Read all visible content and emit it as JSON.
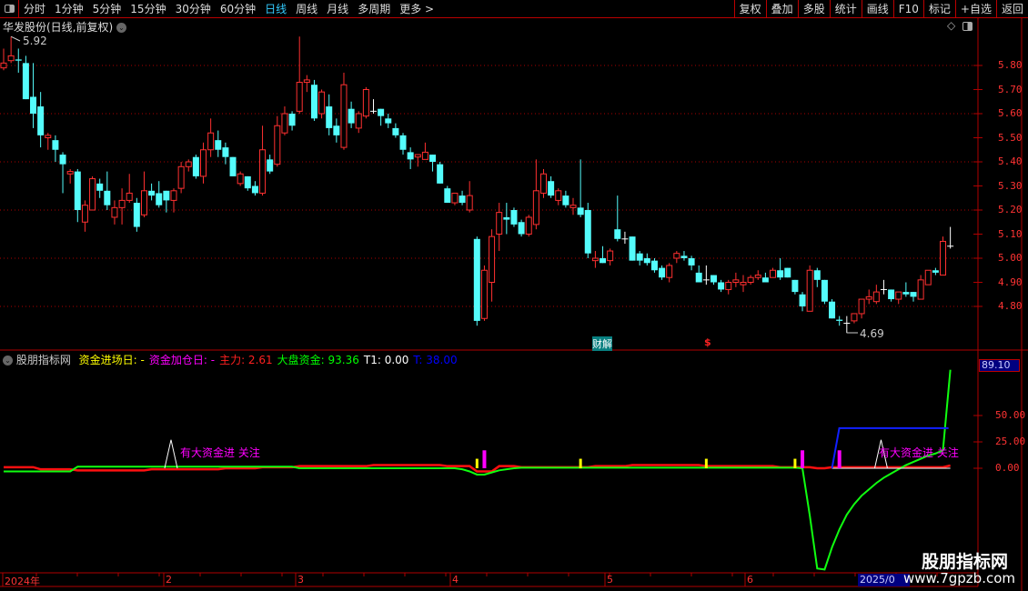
{
  "toolbar": {
    "periods": [
      "分时",
      "1分钟",
      "5分钟",
      "15分钟",
      "30分钟",
      "60分钟",
      "日线",
      "周线",
      "月线",
      "多周期",
      "更多 >"
    ],
    "active": "日线",
    "buttons": [
      "复权",
      "叠加",
      "多股",
      "统计",
      "画线",
      "F10",
      "标记",
      "+自选",
      "返回"
    ]
  },
  "price_panel": {
    "title": "华发股份(日线,前复权)",
    "high_label": "5.92",
    "low_label": "4.69",
    "event_cai": "财解",
    "event_dollar": "$",
    "axis": [
      "5.80",
      "5.70",
      "5.60",
      "5.50",
      "5.40",
      "5.30",
      "5.20",
      "5.10",
      "5.00",
      "4.90",
      "4.80"
    ]
  },
  "indicator_panel": {
    "name": "股朋指标网",
    "legend": [
      {
        "k": "资金进场日:",
        "v": "-",
        "color": "#ffff00"
      },
      {
        "k": "资金加仓日:",
        "v": "-",
        "color": "#ff00ff"
      },
      {
        "k": "主力:",
        "v": "2.61",
        "color": "#ff2020"
      },
      {
        "k": "大盘资金:",
        "v": "93.36",
        "color": "#00ff00"
      },
      {
        "k": "T1:",
        "v": "0.00",
        "color": "#ffffff"
      },
      {
        "k": "T:",
        "v": "38.00",
        "color": "#0000ff"
      }
    ],
    "signal_text": "有大资金进 关注",
    "cursor_value": "89.10",
    "axis": [
      "50.00",
      "25.00",
      "0.00"
    ]
  },
  "time_axis": {
    "labels": [
      "2024年",
      "2",
      "3",
      "4",
      "5",
      "6"
    ],
    "current": "2025/0"
  },
  "watermark": {
    "title": "股朋指标网",
    "url": "www.7gpzb.com"
  },
  "colors": {
    "up": "#ff3030",
    "down": "#54fcfc",
    "grid": "#b00000"
  },
  "chart_data": {
    "type": "candlestick",
    "ohlc": [
      [
        5.79,
        5.87,
        5.78,
        5.81
      ],
      [
        5.82,
        5.92,
        5.81,
        5.84
      ],
      [
        5.825,
        5.87,
        5.77,
        5.82
      ],
      [
        5.81,
        5.84,
        5.66,
        5.66
      ],
      [
        5.67,
        5.81,
        5.54,
        5.6
      ],
      [
        5.63,
        5.69,
        5.46,
        5.51
      ],
      [
        5.5,
        5.52,
        5.45,
        5.51
      ],
      [
        5.49,
        5.51,
        5.4,
        5.45
      ],
      [
        5.43,
        5.44,
        5.27,
        5.39
      ],
      [
        5.35,
        5.37,
        5.31,
        5.36
      ],
      [
        5.36,
        5.37,
        5.15,
        5.2
      ],
      [
        5.15,
        5.24,
        5.11,
        5.22
      ],
      [
        5.2,
        5.34,
        5.2,
        5.33
      ],
      [
        5.31,
        5.33,
        5.25,
        5.28
      ],
      [
        5.28,
        5.36,
        5.2,
        5.22
      ],
      [
        5.17,
        5.24,
        5.14,
        5.21
      ],
      [
        5.21,
        5.29,
        5.14,
        5.24
      ],
      [
        5.24,
        5.35,
        5.23,
        5.27
      ],
      [
        5.23,
        5.25,
        5.11,
        5.13
      ],
      [
        5.18,
        5.36,
        5.17,
        5.28
      ],
      [
        5.28,
        5.31,
        5.24,
        5.26
      ],
      [
        5.27,
        5.32,
        5.21,
        5.22
      ],
      [
        5.28,
        5.28,
        5.19,
        5.24
      ],
      [
        5.24,
        5.29,
        5.19,
        5.28
      ],
      [
        5.29,
        5.4,
        5.27,
        5.38
      ],
      [
        5.38,
        5.41,
        5.36,
        5.4
      ],
      [
        5.42,
        5.43,
        5.33,
        5.34
      ],
      [
        5.34,
        5.48,
        5.31,
        5.45
      ],
      [
        5.45,
        5.58,
        5.42,
        5.52
      ],
      [
        5.49,
        5.53,
        5.42,
        5.45
      ],
      [
        5.46,
        5.48,
        5.39,
        5.42
      ],
      [
        5.42,
        5.42,
        5.34,
        5.34
      ],
      [
        5.31,
        5.36,
        5.3,
        5.35
      ],
      [
        5.34,
        5.34,
        5.28,
        5.29
      ],
      [
        5.3,
        5.32,
        5.26,
        5.27
      ],
      [
        5.27,
        5.55,
        5.26,
        5.45
      ],
      [
        5.41,
        5.43,
        5.35,
        5.36
      ],
      [
        5.39,
        5.59,
        5.38,
        5.55
      ],
      [
        5.52,
        5.63,
        5.51,
        5.6
      ],
      [
        5.6,
        5.61,
        5.53,
        5.55
      ],
      [
        5.61,
        5.92,
        5.6,
        5.73
      ],
      [
        5.73,
        5.76,
        5.69,
        5.74
      ],
      [
        5.72,
        5.74,
        5.57,
        5.58
      ],
      [
        5.6,
        5.7,
        5.58,
        5.69
      ],
      [
        5.63,
        5.68,
        5.51,
        5.54
      ],
      [
        5.55,
        5.58,
        5.48,
        5.51
      ],
      [
        5.46,
        5.77,
        5.45,
        5.72
      ],
      [
        5.62,
        5.65,
        5.54,
        5.56
      ],
      [
        5.54,
        5.61,
        5.52,
        5.6
      ],
      [
        5.59,
        5.71,
        5.58,
        5.7
      ],
      [
        5.61,
        5.66,
        5.6,
        5.61
      ],
      [
        5.62,
        5.62,
        5.55,
        5.59
      ],
      [
        5.58,
        5.6,
        5.54,
        5.56
      ],
      [
        5.54,
        5.56,
        5.5,
        5.51
      ],
      [
        5.51,
        5.52,
        5.43,
        5.45
      ],
      [
        5.44,
        5.46,
        5.37,
        5.41
      ],
      [
        5.42,
        5.43,
        5.38,
        5.43
      ],
      [
        5.41,
        5.48,
        5.41,
        5.44
      ],
      [
        5.43,
        5.43,
        5.36,
        5.4
      ],
      [
        5.39,
        5.4,
        5.31,
        5.31
      ],
      [
        5.29,
        5.3,
        5.23,
        5.23
      ],
      [
        5.23,
        5.27,
        5.22,
        5.27
      ],
      [
        5.26,
        5.28,
        5.22,
        5.23
      ],
      [
        5.2,
        5.32,
        5.19,
        5.26
      ],
      [
        5.08,
        5.09,
        4.72,
        4.74
      ],
      [
        4.75,
        4.97,
        4.74,
        4.95
      ],
      [
        4.9,
        5.12,
        4.82,
        5.09
      ],
      [
        5.1,
        5.23,
        5.03,
        5.19
      ],
      [
        5.17,
        5.23,
        5.1,
        5.16
      ],
      [
        5.2,
        5.21,
        5.13,
        5.14
      ],
      [
        5.15,
        5.16,
        5.09,
        5.1
      ],
      [
        5.1,
        5.18,
        5.09,
        5.17
      ],
      [
        5.14,
        5.41,
        5.12,
        5.28
      ],
      [
        5.27,
        5.37,
        5.25,
        5.35
      ],
      [
        5.32,
        5.34,
        5.25,
        5.26
      ],
      [
        5.24,
        5.29,
        5.22,
        5.28
      ],
      [
        5.26,
        5.28,
        5.21,
        5.22
      ],
      [
        5.21,
        5.25,
        5.18,
        5.22
      ],
      [
        5.21,
        5.41,
        5.17,
        5.18
      ],
      [
        5.2,
        5.23,
        5.0,
        5.02
      ],
      [
        4.99,
        5.03,
        4.96,
        5.0
      ],
      [
        5.0,
        5.05,
        4.98,
        4.98
      ],
      [
        4.99,
        5.04,
        4.97,
        5.03
      ],
      [
        5.12,
        5.26,
        5.07,
        5.08
      ],
      [
        5.08,
        5.11,
        5.06,
        5.08
      ],
      [
        5.09,
        5.09,
        4.99,
        4.99
      ],
      [
        5.02,
        5.03,
        4.97,
        4.99
      ],
      [
        5.0,
        5.02,
        4.97,
        4.98
      ],
      [
        4.99,
        5.0,
        4.94,
        4.95
      ],
      [
        4.96,
        4.97,
        4.91,
        4.92
      ],
      [
        4.92,
        4.98,
        4.9,
        4.97
      ],
      [
        5.0,
        5.03,
        4.98,
        5.02
      ],
      [
        5.01,
        5.03,
        4.99,
        5.0
      ],
      [
        5.0,
        5.01,
        4.95,
        4.97
      ],
      [
        4.94,
        4.97,
        4.9,
        4.9
      ],
      [
        4.91,
        4.97,
        4.89,
        4.91
      ],
      [
        4.93,
        4.93,
        4.89,
        4.9
      ],
      [
        4.9,
        4.91,
        4.86,
        4.87
      ],
      [
        4.87,
        4.91,
        4.85,
        4.9
      ],
      [
        4.9,
        4.94,
        4.88,
        4.91
      ],
      [
        4.89,
        4.93,
        4.86,
        4.9
      ],
      [
        4.9,
        4.93,
        4.89,
        4.92
      ],
      [
        4.92,
        4.95,
        4.91,
        4.93
      ],
      [
        4.92,
        4.94,
        4.9,
        4.9
      ],
      [
        4.92,
        4.96,
        4.92,
        4.95
      ],
      [
        4.95,
        5.0,
        4.91,
        4.92
      ],
      [
        4.96,
        4.96,
        4.92,
        4.92
      ],
      [
        4.91,
        4.91,
        4.85,
        4.86
      ],
      [
        4.85,
        4.86,
        4.78,
        4.8
      ],
      [
        4.78,
        4.97,
        4.78,
        4.95
      ],
      [
        4.95,
        4.96,
        4.88,
        4.91
      ],
      [
        4.91,
        4.91,
        4.81,
        4.82
      ],
      [
        4.82,
        4.83,
        4.75,
        4.75
      ],
      [
        4.745,
        4.76,
        4.72,
        4.74
      ],
      [
        4.73,
        4.76,
        4.69,
        4.73
      ],
      [
        4.74,
        4.77,
        4.73,
        4.77
      ],
      [
        4.77,
        4.83,
        4.75,
        4.83
      ],
      [
        4.83,
        4.87,
        4.81,
        4.84
      ],
      [
        4.82,
        4.89,
        4.81,
        4.86
      ],
      [
        4.87,
        4.91,
        4.85,
        4.87
      ],
      [
        4.87,
        4.87,
        4.82,
        4.83
      ],
      [
        4.83,
        4.86,
        4.81,
        4.86
      ],
      [
        4.86,
        4.9,
        4.84,
        4.85
      ],
      [
        4.86,
        4.86,
        4.82,
        4.84
      ],
      [
        4.83,
        4.93,
        4.83,
        4.91
      ],
      [
        4.89,
        4.95,
        4.89,
        4.95
      ],
      [
        4.95,
        4.96,
        4.93,
        4.94
      ],
      [
        4.93,
        5.09,
        4.93,
        5.07
      ],
      [
        5.05,
        5.13,
        5.04,
        5.05
      ]
    ],
    "price_ylim": [
      4.69,
      5.92
    ],
    "indicator": {
      "ylim": [
        -100,
        100
      ],
      "main_force_red": {
        "base": [
          1,
          -1,
          -2,
          -2,
          -1,
          -1,
          0,
          1,
          2,
          2,
          3,
          3,
          2,
          2,
          1,
          1,
          2,
          3,
          3,
          2,
          2,
          1,
          0,
          0,
          -1,
          -2
        ],
        "last": 2.61
      },
      "market_fund_green_tail": [
        0,
        -45,
        -95,
        -96,
        -75,
        -58,
        -44,
        -34,
        -26,
        -20,
        -14,
        -9,
        -5,
        -1,
        3,
        6,
        9,
        12,
        14,
        17,
        93.36
      ],
      "signal_bars_T1": [
        24,
        120
      ],
      "T_start_bar": 113,
      "T_value": 38,
      "entry_day_bars_yellow": [
        65,
        79,
        96,
        108
      ],
      "add_day_bars_magenta": [
        66,
        109,
        114
      ]
    }
  }
}
